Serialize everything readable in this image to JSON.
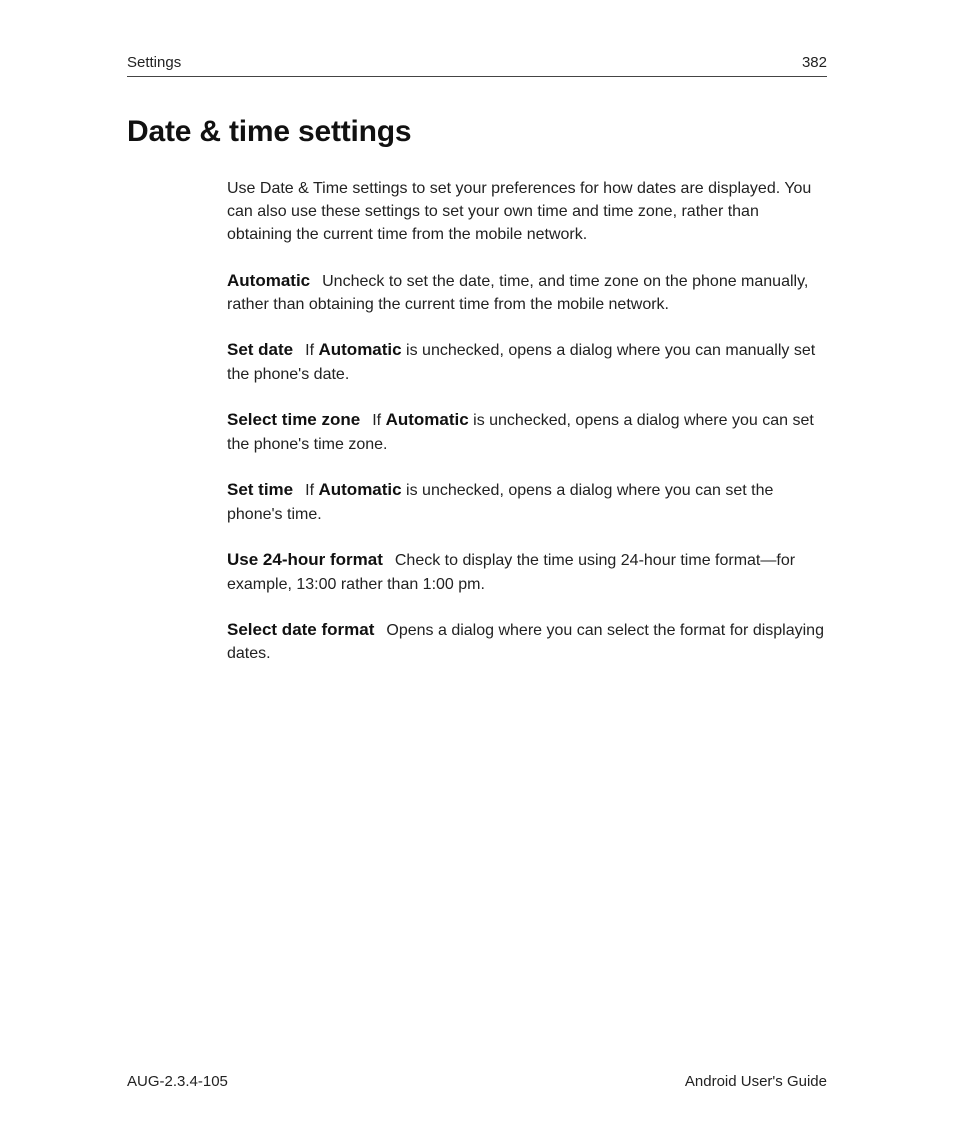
{
  "header": {
    "section": "Settings",
    "page_number": "382"
  },
  "title": "Date & time settings",
  "intro": "Use Date & Time settings to set your preferences for how dates are displayed. You can also use these settings to set your own time and time zone, rather than obtaining the current time from the mobile network.",
  "items": [
    {
      "term": "Automatic",
      "pre": "",
      "bold": "",
      "post": "Uncheck to set the date, time, and time zone on the phone manually, rather than obtaining the current time from the mobile network."
    },
    {
      "term": "Set date",
      "pre": "If ",
      "bold": "Automatic",
      "post": " is unchecked, opens a dialog where you can manually set the phone's date."
    },
    {
      "term": "Select time zone",
      "pre": "If ",
      "bold": "Automatic",
      "post": " is unchecked, opens a dialog where you can set the phone's time zone."
    },
    {
      "term": "Set time",
      "pre": "If ",
      "bold": "Automatic",
      "post": " is unchecked, opens a dialog where you can set the phone's time."
    },
    {
      "term": "Use 24-hour format",
      "pre": "",
      "bold": "",
      "post": "Check to display the time using 24-hour time format—for example, 13:00 rather than 1:00 pm."
    },
    {
      "term": "Select date format",
      "pre": "",
      "bold": "",
      "post": "Opens a dialog where you can select the format for displaying dates."
    }
  ],
  "footer": {
    "left": "AUG-2.3.4-105",
    "right": "Android User's Guide"
  }
}
